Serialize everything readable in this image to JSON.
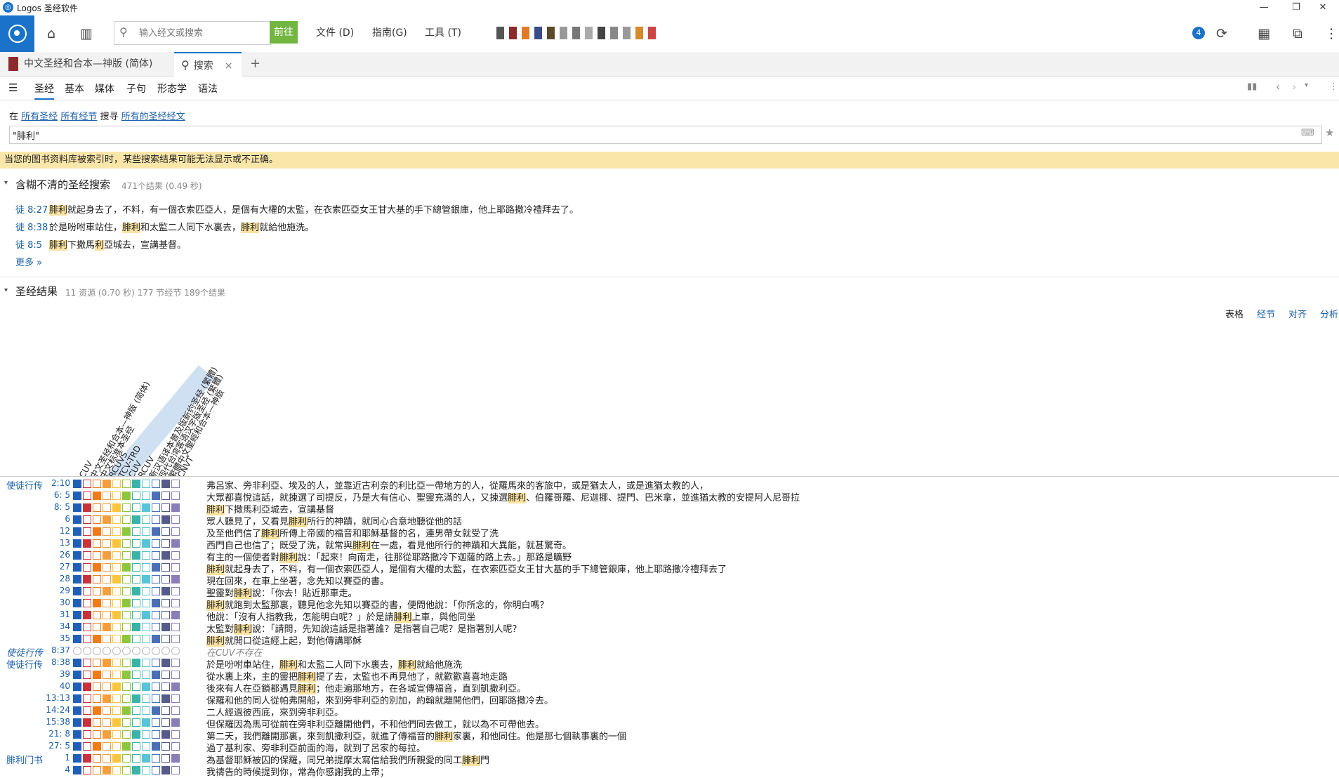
{
  "window": {
    "title": "Logos 圣经软件"
  },
  "toolbar": {
    "search_placeholder": "输入经文或搜索",
    "go_label": "前往",
    "menus": [
      "文件 (D)",
      "指南(G)",
      "工具 (T)"
    ],
    "sync_badge": "4"
  },
  "tabs": [
    {
      "label": "中文圣经和合本—神版 (简体)"
    },
    {
      "label": "搜索"
    }
  ],
  "search_types": [
    "圣经",
    "基本",
    "媒体",
    "子句",
    "形态学",
    "语法"
  ],
  "scope": {
    "prefix": "在",
    "all_bibles": "所有圣经",
    "all_verses": "所有经节",
    "search": "搜寻",
    "target": "所有的圣经经文"
  },
  "query": "\"腓利\"",
  "warning": "当您的图书资料库被索引时，某些搜索结果可能无法显示或不正确。",
  "fuzzy": {
    "title": "含糊不清的圣经搜索",
    "meta": "471个结果 (0.49 秒)",
    "more": "更多 »",
    "results": [
      {
        "ref": "徒 8:27",
        "parts": [
          [
            "腓利",
            true
          ],
          [
            "就起身去了，不料，有一個衣索匹亞人，是個有大權的太監，在衣索匹亞女王甘大基的手下總管銀庫，他上耶路撒冷禮拜去了。",
            false
          ]
        ]
      },
      {
        "ref": "徒 8:38",
        "parts": [
          [
            "於是吩咐車站住，",
            false
          ],
          [
            "腓利",
            true
          ],
          [
            "和太監二人同下水裏去，",
            false
          ],
          [
            "腓利",
            true
          ],
          [
            "就給他施洗。",
            false
          ]
        ]
      },
      {
        "ref": "徒 8:5",
        "parts": [
          [
            "腓利",
            true
          ],
          [
            "下撒馬",
            false
          ],
          [
            "利",
            true
          ],
          [
            "亞城去，宣講基督。",
            false
          ]
        ]
      }
    ]
  },
  "bible_results": {
    "title": "圣经结果",
    "meta": "11 资源 (0.70 秒) 177 节经节 189个结果",
    "views": [
      "表格",
      "经节",
      "对齐",
      "分析"
    ],
    "columns": [
      "CUV",
      "中文圣经和合本—神版 (简体)",
      "中文标准本圣经",
      "RCUVS",
      "TCV-TRD",
      "CUV",
      "RCUV",
      "新汉语译本普及版新约圣经 (繁體)",
      "现代台湾客语汉字版圣经 (繁體)",
      "繁體中文聖經和合本—神版",
      "CNVT"
    ],
    "rows": [
      {
        "book": "使徒行传",
        "ref": "2:10",
        "text": [
          [
            "弗呂家、旁非利亞、埃及的人，並靠近古利奈的利比亞一帶地方的人，從羅馬來的客旅中，或是猶太人，或是進猶太教的人，",
            false
          ]
        ]
      },
      {
        "book": "",
        "ref": "6: 5",
        "text": [
          [
            "大眾都喜悅這話，就揀選了司提反，乃是大有信心、聖靈充滿的人，又揀選",
            false
          ],
          [
            "腓利",
            true
          ],
          [
            "、伯羅哥羅、尼迦挪、提門、巴米拿，並進猶太教的安提阿人尼哥拉",
            false
          ]
        ]
      },
      {
        "book": "",
        "ref": "8: 5",
        "text": [
          [
            "腓利",
            true
          ],
          [
            "下撒馬利亞城去，宣講基督",
            false
          ]
        ]
      },
      {
        "book": "",
        "ref": "6",
        "text": [
          [
            "眾人聽見了，又看見",
            false
          ],
          [
            "腓利",
            true
          ],
          [
            "所行的神蹟，就同心合意地聽從他的話",
            false
          ]
        ]
      },
      {
        "book": "",
        "ref": "12",
        "text": [
          [
            "及至他們信了",
            false
          ],
          [
            "腓利",
            true
          ],
          [
            "所傳上帝國的福音和耶穌基督的名，連男帶女就受了洗",
            false
          ]
        ]
      },
      {
        "book": "",
        "ref": "13",
        "text": [
          [
            "西門自己也信了；既受了洗，就常與",
            false
          ],
          [
            "腓利",
            true
          ],
          [
            "在一處，看見他所行的神蹟和大異能，就甚驚奇。",
            false
          ]
        ]
      },
      {
        "book": "",
        "ref": "26",
        "text": [
          [
            "有主的一個使者對",
            false
          ],
          [
            "腓利",
            true
          ],
          [
            "說：「起來！向南走，往那從耶路撒冷下迦薩的路上去。」那路是曠野",
            false
          ]
        ]
      },
      {
        "book": "",
        "ref": "27",
        "text": [
          [
            "腓利",
            true
          ],
          [
            "就起身去了，不料，有一個衣索匹亞人，是個有大權的太監，在衣索匹亞女王甘大基的手下總管銀庫，他上耶路撒冷禮拜去了",
            false
          ]
        ]
      },
      {
        "book": "",
        "ref": "28",
        "text": [
          [
            "現在回來，在車上坐著，念先知以賽亞的書。",
            false
          ]
        ]
      },
      {
        "book": "",
        "ref": "29",
        "text": [
          [
            "聖靈對",
            false
          ],
          [
            "腓利",
            true
          ],
          [
            "說：「你去！貼近那車走。",
            false
          ]
        ]
      },
      {
        "book": "",
        "ref": "30",
        "text": [
          [
            "腓利",
            true
          ],
          [
            "就跑到太監那裏，聽見他念先知以賽亞的書，便問他說：「你所念的，你明白嗎？",
            false
          ]
        ]
      },
      {
        "book": "",
        "ref": "31",
        "text": [
          [
            "他說：「沒有人指教我，怎能明白呢？」於是請",
            false
          ],
          [
            "腓利",
            true
          ],
          [
            "上車，與他同坐",
            false
          ]
        ]
      },
      {
        "book": "",
        "ref": "34",
        "text": [
          [
            "太監對",
            false
          ],
          [
            "腓利",
            true
          ],
          [
            "說：「請問，先知說這話是指著誰？是指著自己呢？是指著別人呢？",
            false
          ]
        ]
      },
      {
        "book": "",
        "ref": "35",
        "text": [
          [
            "腓利",
            true
          ],
          [
            "就開口從這經上起，對他傳講耶穌",
            false
          ]
        ]
      },
      {
        "book": "使徒行传",
        "ref": "8:37",
        "missing": true,
        "text": [
          [
            "在CUV不存在",
            false
          ]
        ]
      },
      {
        "book": "使徒行传",
        "ref": "8:38",
        "text": [
          [
            "於是吩咐車站住，",
            false
          ],
          [
            "腓利",
            true
          ],
          [
            "和太監二人同下水裏去，",
            false
          ],
          [
            "腓利",
            true
          ],
          [
            "就給他施洗",
            false
          ]
        ]
      },
      {
        "book": "",
        "ref": "39",
        "text": [
          [
            "從水裏上來，主的靈把",
            false
          ],
          [
            "腓利",
            true
          ],
          [
            "提了去，太監也不再見他了，就歡歡喜喜地走路",
            false
          ]
        ]
      },
      {
        "book": "",
        "ref": "40",
        "text": [
          [
            "後來有人在亞鎖都遇見",
            false
          ],
          [
            "腓利",
            true
          ],
          [
            "；他走遍那地方，在各城宣傳福音，直到凱撒利亞。",
            false
          ]
        ]
      },
      {
        "book": "",
        "ref": "13:13",
        "text": [
          [
            "保羅和他的同人從帕弗開船，來到旁非利亞的別加，約翰就離開他們，回耶路撒冷去。",
            false
          ]
        ]
      },
      {
        "book": "",
        "ref": "14:24",
        "text": [
          [
            "二人經過彼西底，來到旁非利亞。",
            false
          ]
        ]
      },
      {
        "book": "",
        "ref": "15:38",
        "text": [
          [
            "但保羅因為馬可從前在旁非利亞離開他們，不和他們同去做工，就以為不可帶他去。",
            false
          ]
        ]
      },
      {
        "book": "",
        "ref": "21: 8",
        "text": [
          [
            "第二天，我們離開那裏，來到凱撒利亞，就進了傳福音的",
            false
          ],
          [
            "腓利",
            true
          ],
          [
            "家裏，和他同住。他是那七個執事裏的一個",
            false
          ]
        ]
      },
      {
        "book": "",
        "ref": "27: 5",
        "text": [
          [
            "過了基利家、旁非利亞前面的海，就到了呂家的每拉。",
            false
          ]
        ]
      },
      {
        "book": "腓利门书",
        "ref": "1",
        "text": [
          [
            "為基督耶穌被囚的保羅，同兄弟提摩太寫信給我們所親愛的同工",
            false
          ],
          [
            "腓利",
            true
          ],
          [
            "門",
            false
          ]
        ]
      },
      {
        "book": "",
        "ref": "4",
        "text": [
          [
            "我禱告的時候提到你，常為你感謝我的上帝；",
            false
          ]
        ]
      }
    ]
  },
  "colors": {
    "accent": "#1a73c8",
    "go": "#72b541",
    "warning_bg": "#fbe6a9",
    "highlight": "#fbe2a0"
  }
}
